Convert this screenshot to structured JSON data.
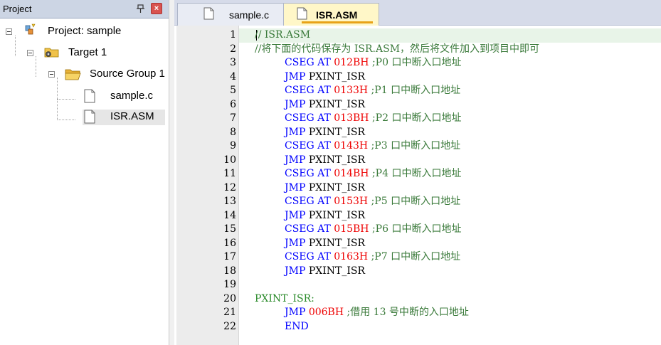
{
  "project_panel": {
    "title": "Project",
    "tree": {
      "project": "Project: sample",
      "target": "Target 1",
      "group": "Source Group 1",
      "files": [
        "sample.c",
        "ISR.ASM"
      ]
    }
  },
  "editor": {
    "tabs": [
      {
        "label": "sample.c",
        "active": false
      },
      {
        "label": "ISR.ASM",
        "active": true
      }
    ],
    "line_numbers": [
      "1",
      "2",
      "3",
      "4",
      "5",
      "6",
      "7",
      "8",
      "9",
      "10",
      "11",
      "12",
      "13",
      "14",
      "15",
      "16",
      "17",
      "18",
      "19",
      "20",
      "21",
      "22"
    ],
    "lines": {
      "l1": {
        "text": "// ISR.ASM"
      },
      "l2": {
        "text": "//将下面的代码保存为 ISR.ASM，然后将文件加入到项目中即可"
      },
      "l3": {
        "kw": "CSEG AT",
        "num": "012BH",
        "cmt": ";P0 口中断入口地址"
      },
      "l4": {
        "kw": "JMP",
        "arg": "PXINT_ISR"
      },
      "l5": {
        "kw": "CSEG AT",
        "num": "0133H",
        "cmt": ";P1 口中断入口地址"
      },
      "l6": {
        "kw": "JMP",
        "arg": "PXINT_ISR"
      },
      "l7": {
        "kw": "CSEG AT",
        "num": "013BH",
        "cmt": ";P2 口中断入口地址"
      },
      "l8": {
        "kw": "JMP",
        "arg": "PXINT_ISR"
      },
      "l9": {
        "kw": "CSEG AT",
        "num": "0143H",
        "cmt": ";P3 口中断入口地址"
      },
      "l10": {
        "kw": "JMP",
        "arg": "PXINT_ISR"
      },
      "l11": {
        "kw": "CSEG AT",
        "num": "014BH",
        "cmt": ";P4 口中断入口地址"
      },
      "l12": {
        "kw": "JMP",
        "arg": "PXINT_ISR"
      },
      "l13": {
        "kw": "CSEG AT",
        "num": "0153H",
        "cmt": ";P5 口中断入口地址"
      },
      "l14": {
        "kw": "JMP",
        "arg": "PXINT_ISR"
      },
      "l15": {
        "kw": "CSEG AT",
        "num": "015BH",
        "cmt": ";P6 口中断入口地址"
      },
      "l16": {
        "kw": "JMP",
        "arg": "PXINT_ISR"
      },
      "l17": {
        "kw": "CSEG AT",
        "num": "0163H",
        "cmt": ";P7 口中断入口地址"
      },
      "l18": {
        "kw": "JMP",
        "arg": "PXINT_ISR"
      },
      "l19": {
        "text": ""
      },
      "l20": {
        "label": "PXINT_ISR:"
      },
      "l21": {
        "kw": "JMP",
        "num": "006BH",
        "cmt": ";借用 13 号中断的入口地址"
      },
      "l22": {
        "kw": "END"
      }
    }
  },
  "colors": {
    "keyword": "#0000ff",
    "number": "#ee0000",
    "comment": "#3a7a3a",
    "label": "#2a8a2a",
    "active_tab": "#fff7c8",
    "tab_underline": "#e8a317"
  },
  "icons": {
    "pin": "pin-icon",
    "close": "close-icon",
    "project": "project-icon",
    "target": "target-folder-icon",
    "group": "folder-open-icon",
    "file": "file-icon"
  }
}
